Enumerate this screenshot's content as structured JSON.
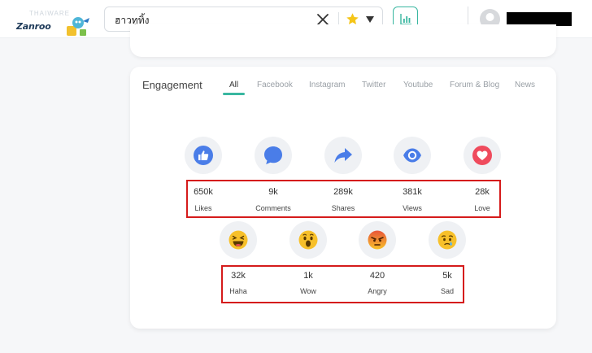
{
  "header": {
    "logo_text": "Zanroo",
    "watermark": "THAIWARE",
    "search": {
      "value": "ฮาวทูทิ้ง"
    }
  },
  "engagement": {
    "title": "Engagement",
    "tabs": [
      {
        "label": "All",
        "active": true
      },
      {
        "label": "Facebook",
        "active": false
      },
      {
        "label": "Instagram",
        "active": false
      },
      {
        "label": "Twitter",
        "active": false
      },
      {
        "label": "Youtube",
        "active": false
      },
      {
        "label": "Forum & Blog",
        "active": false
      },
      {
        "label": "News",
        "active": false
      }
    ],
    "stats_row1": [
      {
        "icon": "like-icon",
        "value": "650k",
        "label": "Likes"
      },
      {
        "icon": "comment-icon",
        "value": "9k",
        "label": "Comments"
      },
      {
        "icon": "share-icon",
        "value": "289k",
        "label": "Shares"
      },
      {
        "icon": "eye-icon",
        "value": "381k",
        "label": "Views"
      },
      {
        "icon": "heart-icon",
        "value": "28k",
        "label": "Love"
      }
    ],
    "stats_row2": [
      {
        "icon": "haha-icon",
        "value": "32k",
        "label": "Haha"
      },
      {
        "icon": "wow-icon",
        "value": "1k",
        "label": "Wow"
      },
      {
        "icon": "angry-icon",
        "value": "420",
        "label": "Angry"
      },
      {
        "icon": "sad-icon",
        "value": "5k",
        "label": "Sad"
      }
    ]
  },
  "colors": {
    "accent": "#39b7a0",
    "facebook_blue": "#4a7de8",
    "love_red": "#ef4b5d",
    "emoji_yellow": "#f7c02a",
    "highlight_red": "#d51b1b"
  }
}
